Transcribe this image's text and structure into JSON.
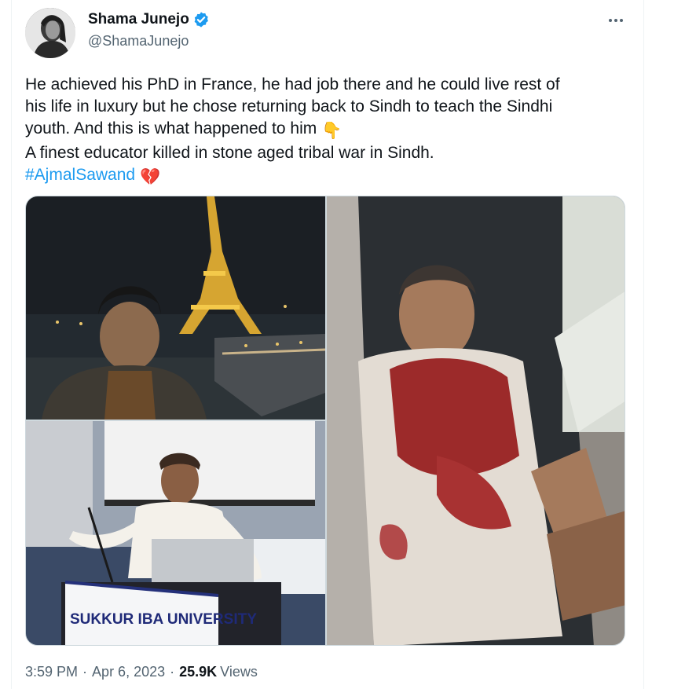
{
  "author": {
    "display_name": "Shama Junejo",
    "handle": "@ShamaJunejo",
    "verified": true
  },
  "tweet": {
    "lines": [
      "He achieved his PhD in France, he had job there and he could live rest of",
      "his life in luxury but he chose returning back to Sindh to teach the Sindhi",
      "youth. And this is what happened to him",
      "A finest educator killed in stone aged tribal war in Sindh."
    ],
    "emoji_pointing_down": "👇",
    "hashtag": "#AjmalSawand",
    "emoji_broken_heart": "💔"
  },
  "media": {
    "photo3_banner_text": "SUKKUR IBA UNIVERSITY"
  },
  "meta": {
    "time": "3:59 PM",
    "separator": "·",
    "date": "Apr 6, 2023",
    "views_count": "25.9K",
    "views_label": "Views"
  },
  "colors": {
    "accent": "#1d9bf0",
    "text": "#0f1419",
    "secondary": "#536471"
  },
  "icons": [
    "verified-badge-icon",
    "more-options-icon"
  ]
}
